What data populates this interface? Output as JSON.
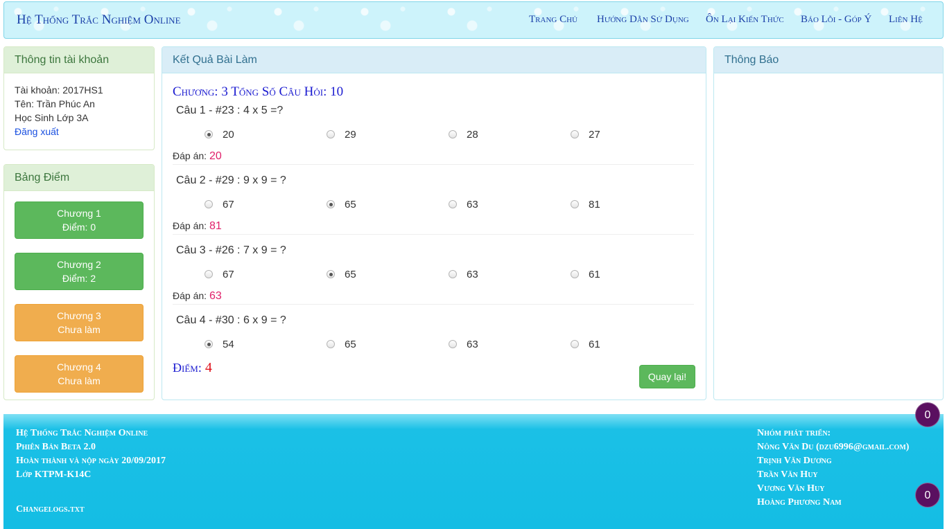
{
  "header": {
    "brand": "Hệ Thống Trắc Nghiệm Online",
    "nav": [
      "Trang Chủ",
      "Hướng Dẫn Sử Dụng",
      "Ôn Lại Kiến Thức",
      "Báo Lỗi - Góp Ý",
      "Liên Hệ"
    ]
  },
  "account": {
    "title": "Thông tin tài khoản",
    "username": "Tài khoản: 2017HS1",
    "name": "Tên: Trần Phúc An",
    "class": "Học Sinh Lớp 3A",
    "logout": "Đăng xuất"
  },
  "scoreboard": {
    "title": "Bảng Điểm",
    "chapters": [
      {
        "name": "Chương 1",
        "status": "Điểm: 0"
      },
      {
        "name": "Chương 2",
        "status": "Điểm: 2"
      },
      {
        "name": "Chương 3",
        "status": "Chưa làm"
      },
      {
        "name": "Chương 4",
        "status": "Chưa làm"
      }
    ]
  },
  "result": {
    "title": "Kết Quả Bài Làm",
    "heading": "Chương: 3 Tổng Số Câu Hỏi: 10",
    "answer_label": "Đáp án:",
    "questions": [
      {
        "text": "Câu 1 - #23 : 4 x 5 =?",
        "options": [
          "20",
          "29",
          "28",
          "27"
        ],
        "selected": 0,
        "answer": "20"
      },
      {
        "text": "Câu 2 - #29 : 9 x 9 = ?",
        "options": [
          "67",
          "65",
          "63",
          "81"
        ],
        "selected": 1,
        "answer": "81"
      },
      {
        "text": "Câu 3 - #26 : 7 x 9 = ?",
        "options": [
          "67",
          "65",
          "63",
          "61"
        ],
        "selected": 1,
        "answer": "63"
      },
      {
        "text": "Câu 4 - #30 : 6 x 9 = ?",
        "options": [
          "54",
          "65",
          "63",
          "61"
        ],
        "selected": 0,
        "answer": null
      }
    ],
    "score_label": "Điểm:",
    "score_value": "4",
    "back_button": "Quay lại!"
  },
  "notice": {
    "title": "Thông Báo"
  },
  "footer": {
    "left": [
      "Hệ Thống Trắc Nghiệm Online",
      "Phiên Bản Beta 2.0",
      "Hoàn thành và nộp ngày 20/09/2017",
      "Lớp KTPM-K14C"
    ],
    "changelog": "Changelogs.txt",
    "team_title": "Nhóm phát triển:",
    "team": [
      "Nông Văn Du (dzu6996@gmail.com)",
      "Trịnh Văn Dương",
      "Trần Văn Huy",
      "Vương Văn Huy",
      "Hoàng Phương Nam"
    ],
    "badges": [
      "0",
      "0"
    ]
  }
}
